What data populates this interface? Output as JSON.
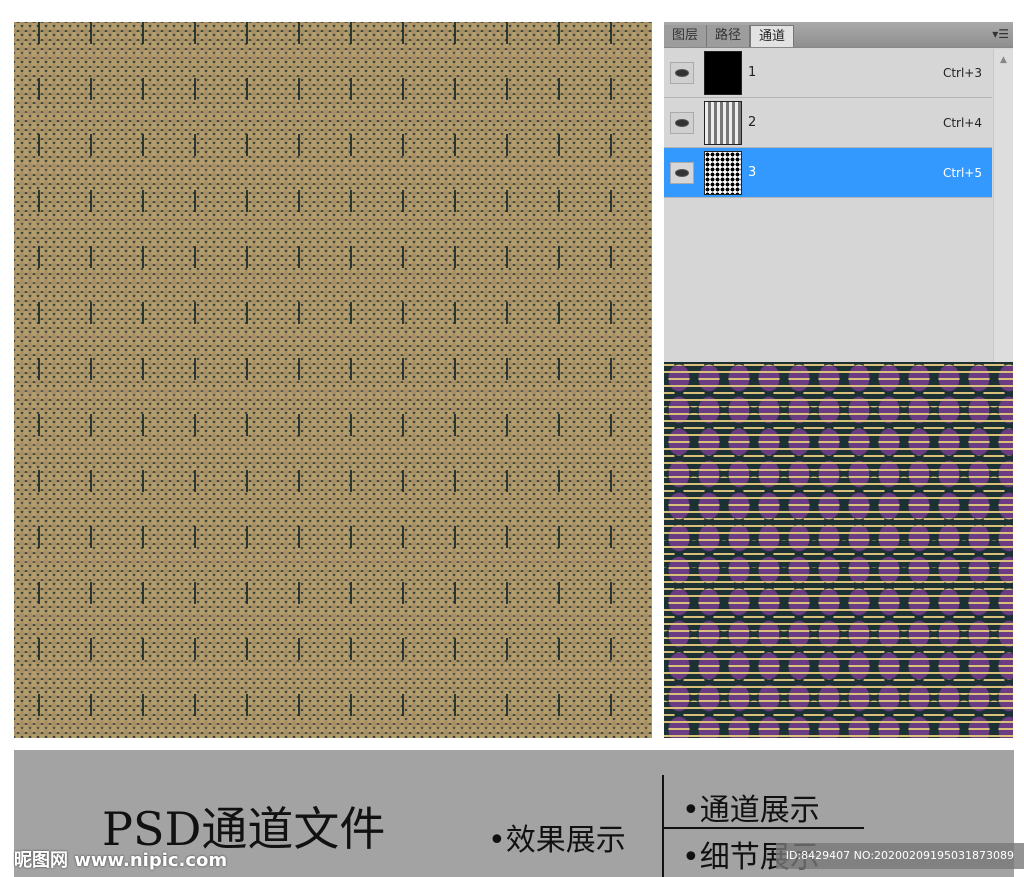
{
  "panel": {
    "tabs": [
      "图层",
      "路径",
      "通道"
    ],
    "active_tab": "通道",
    "channels": [
      {
        "name": "1",
        "shortcut": "Ctrl+3",
        "visible": true,
        "selected": false
      },
      {
        "name": "2",
        "shortcut": "Ctrl+4",
        "visible": true,
        "selected": false
      },
      {
        "name": "3",
        "shortcut": "Ctrl+5",
        "visible": true,
        "selected": true
      }
    ]
  },
  "colors": {
    "selection": "#3399ff",
    "pattern_dark": "#1d3134",
    "pattern_tan": "#b39d6c",
    "detail_purple": "#6b3b84",
    "detail_yellow": "#d9c07a"
  },
  "footer": {
    "title": "PSD通道文件",
    "effect": "•效果展示",
    "channel": "•通道展示",
    "detail": "•细节展示"
  },
  "watermark": {
    "logo": "昵图网 www.nipic.com",
    "id": "ID:8429407 NO:20200209195031873089"
  }
}
